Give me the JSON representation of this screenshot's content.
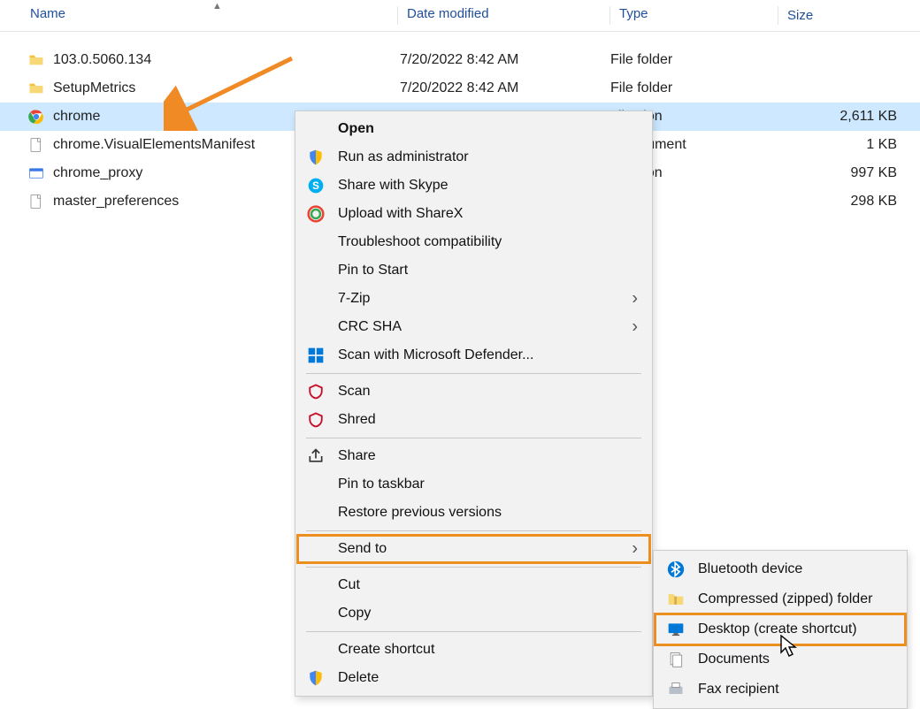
{
  "columns": {
    "name": "Name",
    "date": "Date modified",
    "type": "Type",
    "size": "Size"
  },
  "files": [
    {
      "name": "103.0.5060.134",
      "date": "7/20/2022 8:42 AM",
      "type": "File folder",
      "size": "",
      "icon": "folder"
    },
    {
      "name": "SetupMetrics",
      "date": "7/20/2022 8:42 AM",
      "type": "File folder",
      "size": "",
      "icon": "folder"
    },
    {
      "name": "chrome",
      "date": "",
      "type": "plication",
      "size": "2,611 KB",
      "icon": "chrome",
      "selected": true
    },
    {
      "name": "chrome.VisualElementsManifest",
      "date": "",
      "type": "L Document",
      "size": "1 KB",
      "icon": "generic"
    },
    {
      "name": "chrome_proxy",
      "date": "",
      "type": "plication",
      "size": "997 KB",
      "icon": "proxy"
    },
    {
      "name": "master_preferences",
      "date": "",
      "type": "",
      "size": "298 KB",
      "icon": "generic"
    }
  ],
  "context_menu": {
    "open": "Open",
    "run_admin": "Run as administrator",
    "skype": "Share with Skype",
    "sharex": "Upload with ShareX",
    "troubleshoot": "Troubleshoot compatibility",
    "pin_start": "Pin to Start",
    "sevenzip": "7-Zip",
    "crc": "CRC SHA",
    "defender": "Scan with Microsoft Defender...",
    "scan": "Scan",
    "shred": "Shred",
    "share": "Share",
    "pin_taskbar": "Pin to taskbar",
    "restore": "Restore previous versions",
    "send_to": "Send to",
    "cut": "Cut",
    "copy": "Copy",
    "shortcut": "Create shortcut",
    "delete": "Delete"
  },
  "submenu": {
    "bluetooth": "Bluetooth device",
    "zipped": "Compressed (zipped) folder",
    "desktop": "Desktop (create shortcut)",
    "documents": "Documents",
    "fax": "Fax recipient"
  }
}
